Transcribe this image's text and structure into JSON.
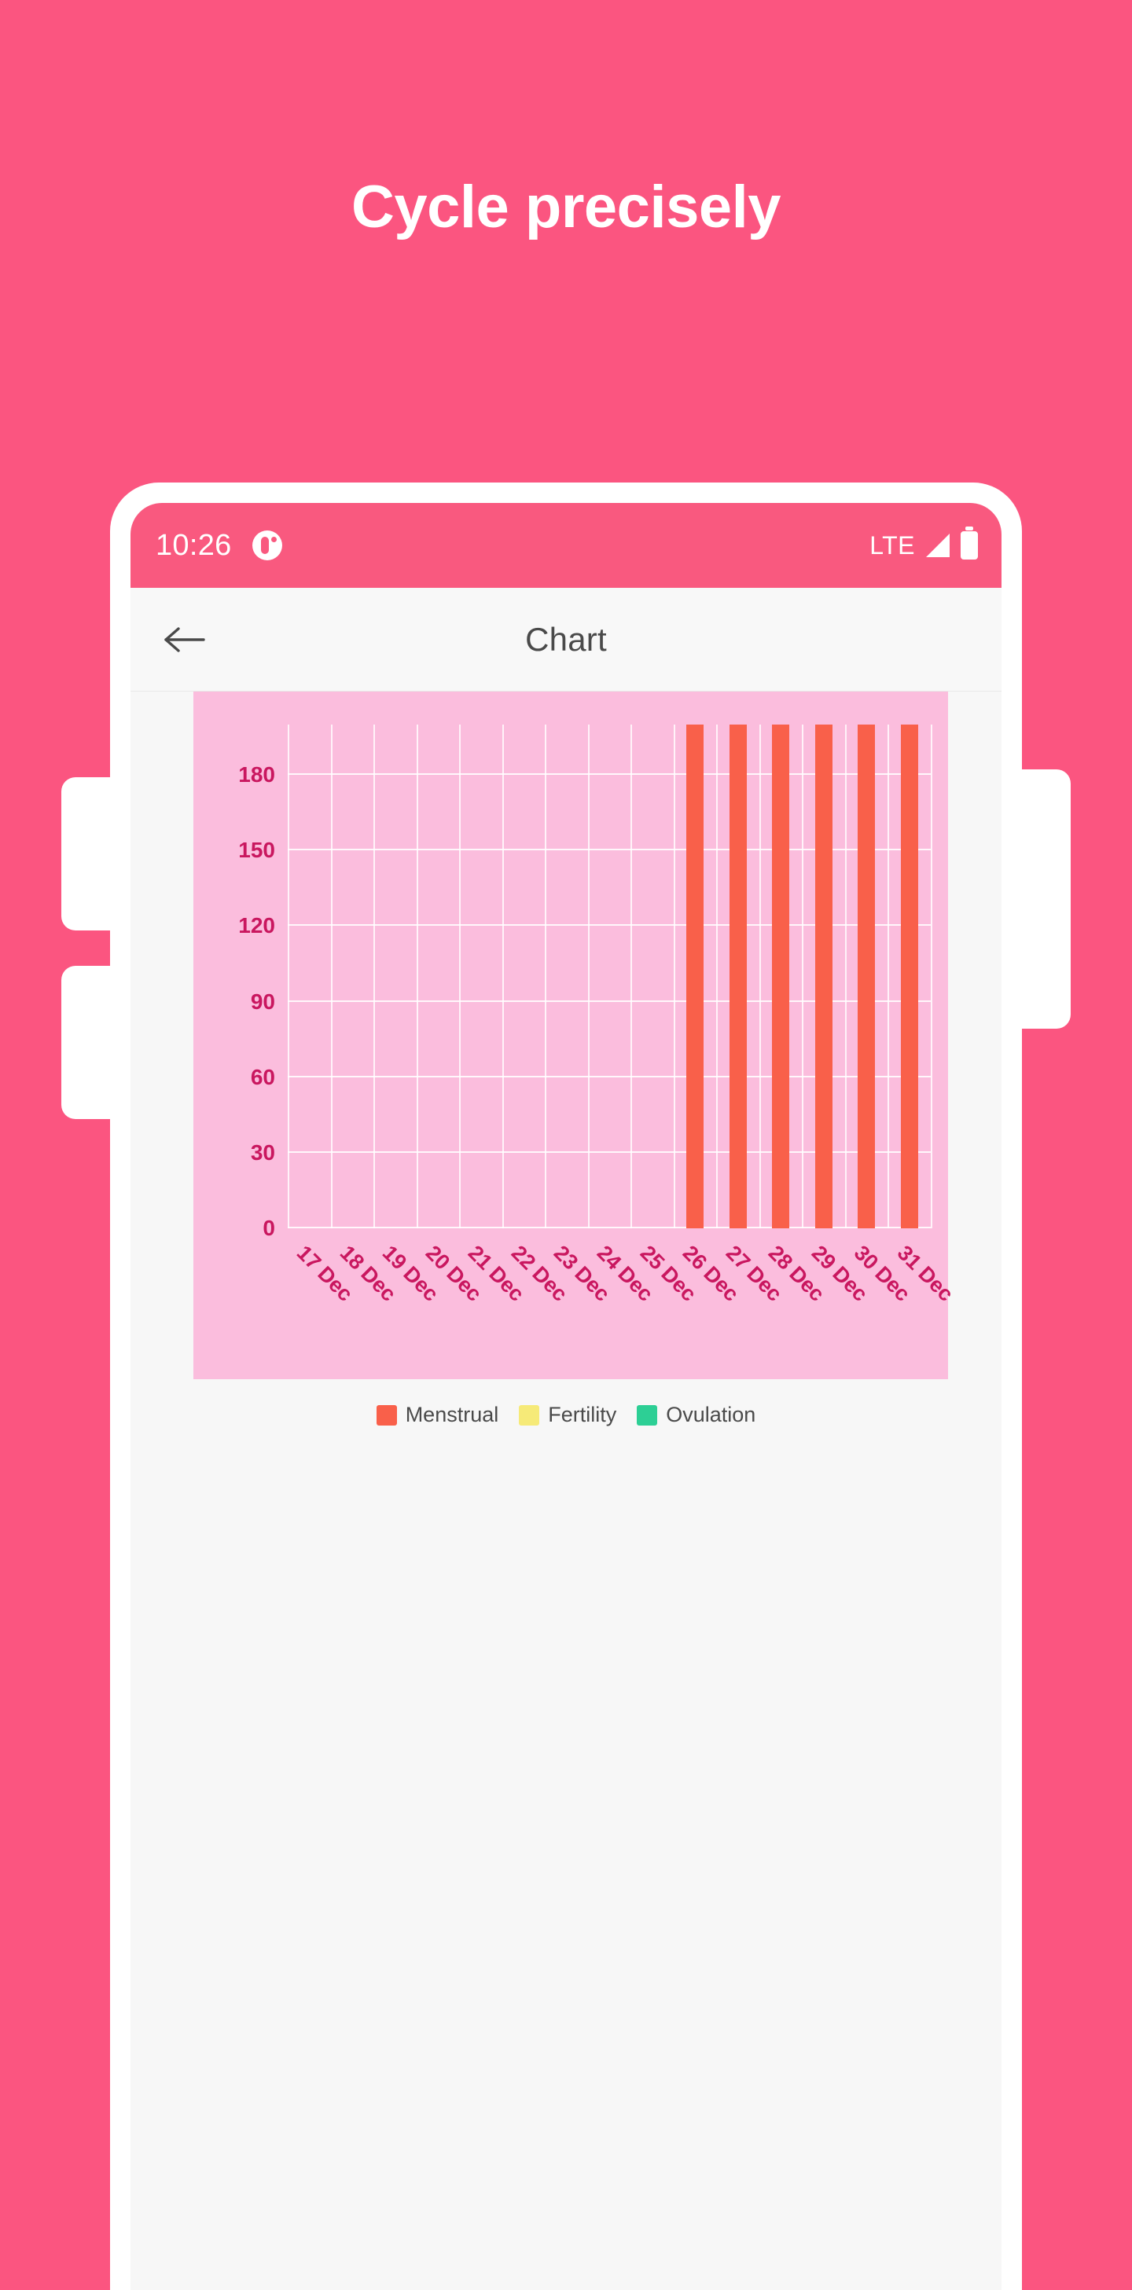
{
  "page": {
    "background_color": "#fb5580",
    "headline": "Cycle precisely"
  },
  "phone": {
    "status_bar": {
      "time": "10:26",
      "app_icon": "drop-app-icon",
      "network_label": "LTE",
      "signal_icon": "signal-bars-icon",
      "battery_icon": "battery-full-icon",
      "background_color": "#f9597f"
    },
    "app_bar": {
      "back_icon": "arrow-left-icon",
      "title": "Chart",
      "background_color": "#f8f8f8",
      "title_color": "#4a4a4a"
    }
  },
  "chart_data": {
    "type": "bar",
    "title": "",
    "xlabel": "",
    "ylabel": "",
    "panel_background": "#fbbddd",
    "grid": true,
    "tick_color": "#c9175f",
    "ylim": [
      0,
      200
    ],
    "yticks": [
      0,
      30,
      60,
      90,
      120,
      150,
      180
    ],
    "ytick_labels": [
      "0",
      "30",
      "60",
      "90",
      "120",
      "150",
      "180"
    ],
    "categories": [
      "17 Dec",
      "18 Dec",
      "19 Dec",
      "20 Dec",
      "21 Dec",
      "22 Dec",
      "23 Dec",
      "24 Dec",
      "25 Dec",
      "26 Dec",
      "27 Dec",
      "28 Dec",
      "29 Dec",
      "30 Dec",
      "31 Dec"
    ],
    "series": [
      {
        "name": "Menstrual",
        "color": "#f9604a",
        "values": [
          0,
          0,
          0,
          0,
          0,
          0,
          0,
          0,
          0,
          200,
          200,
          200,
          200,
          200,
          200
        ]
      },
      {
        "name": "Fertility",
        "color": "#f6ea78",
        "values": [
          0,
          0,
          0,
          0,
          0,
          0,
          0,
          0,
          0,
          0,
          0,
          0,
          0,
          0,
          0
        ]
      },
      {
        "name": "Ovulation",
        "color": "#2dcf95",
        "values": [
          0,
          0,
          0,
          0,
          0,
          0,
          0,
          0,
          0,
          0,
          0,
          0,
          0,
          0,
          0
        ]
      }
    ],
    "legend": {
      "position": "bottom",
      "entries": [
        {
          "label": "Menstrual",
          "color": "#f9604a"
        },
        {
          "label": "Fertility",
          "color": "#f6ea78"
        },
        {
          "label": "Ovulation",
          "color": "#2dcf95"
        }
      ]
    }
  }
}
